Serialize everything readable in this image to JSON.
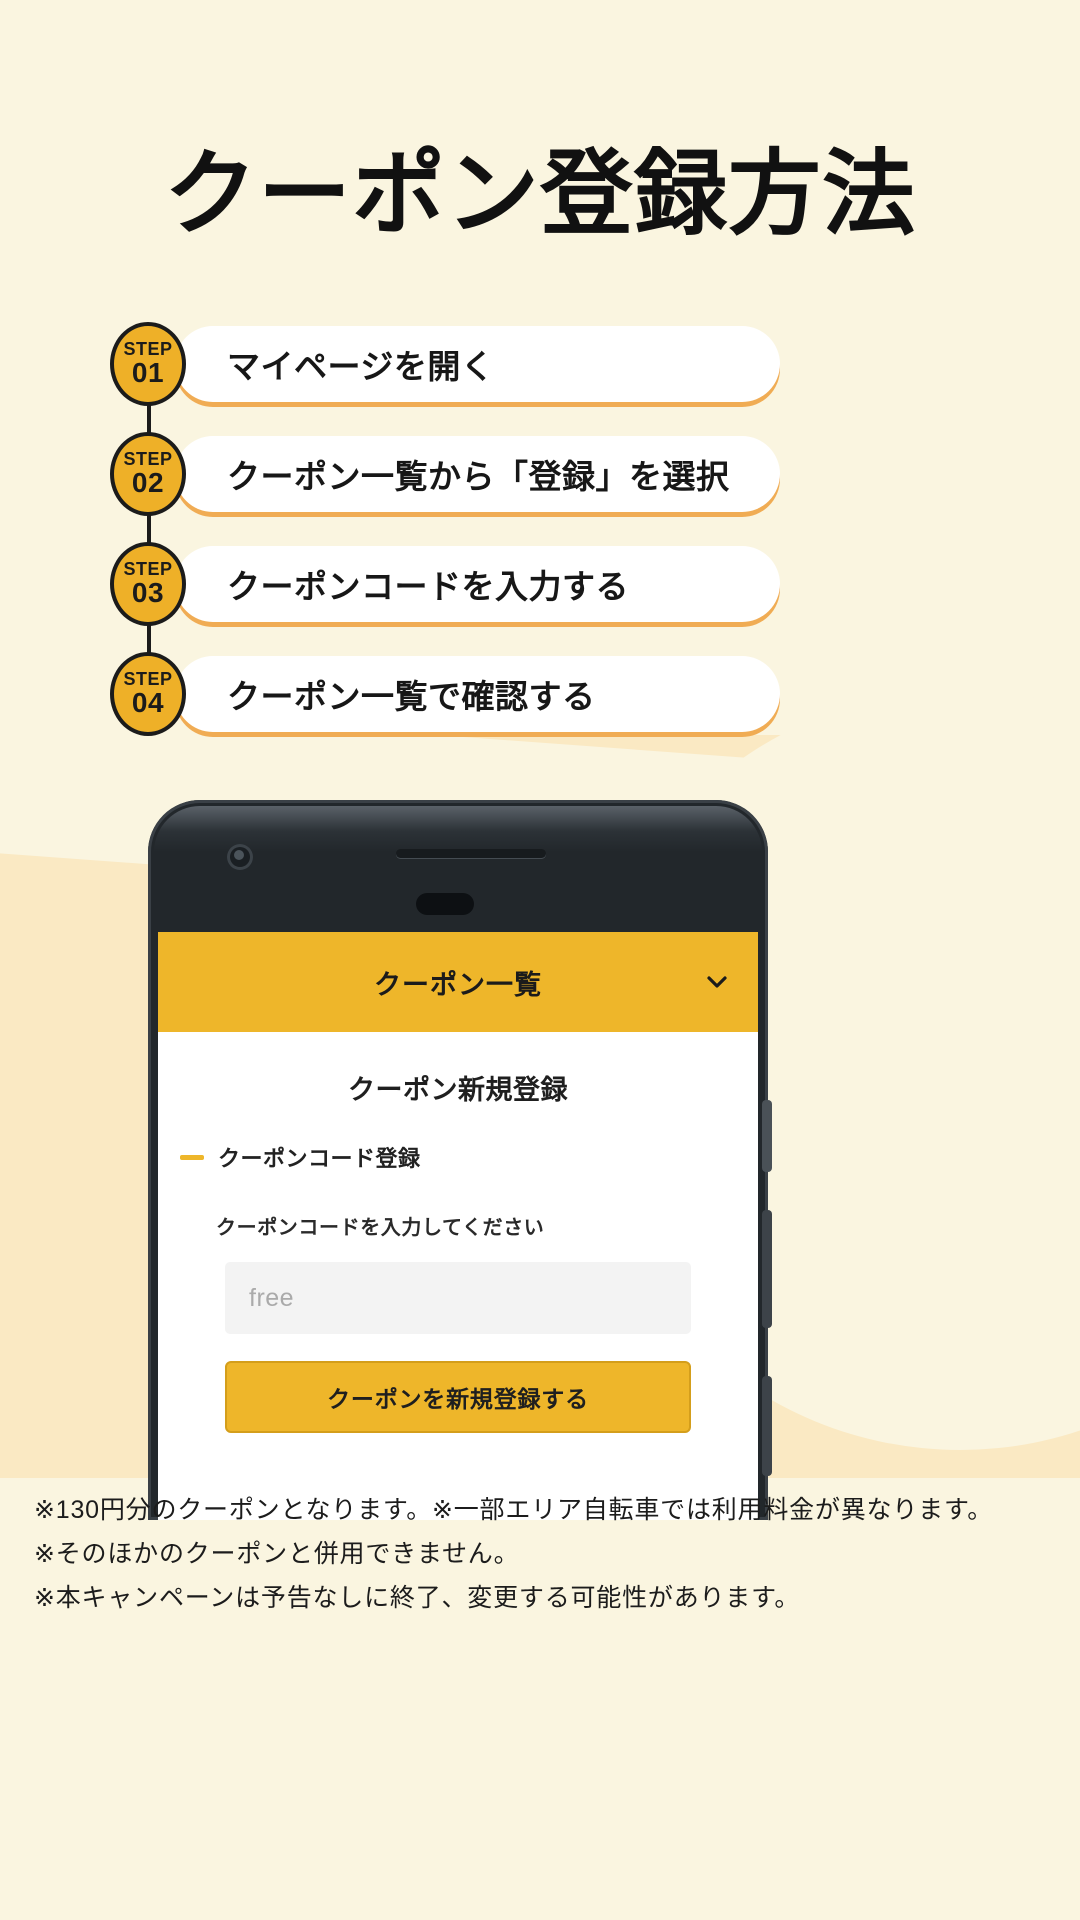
{
  "page": {
    "title": "クーポン登録方法",
    "background_color": "#faf5e0",
    "accent_color": "#eeb62a",
    "band_color": "#fae9c3"
  },
  "steps": [
    {
      "badge_word": "STEP",
      "badge_number": "01",
      "label": "マイページを開く"
    },
    {
      "badge_word": "STEP",
      "badge_number": "02",
      "label": "クーポン一覧から「登録」を選択"
    },
    {
      "badge_word": "STEP",
      "badge_number": "03",
      "label": "クーポンコードを入力する"
    },
    {
      "badge_word": "STEP",
      "badge_number": "04",
      "label": "クーポン一覧で確認する"
    }
  ],
  "phone": {
    "app": {
      "header": {
        "title": "クーポン一覧",
        "chevron_icon": "chevron-down-icon"
      },
      "section_title": "クーポン新規登録",
      "subhead": "クーポンコード登録",
      "field_label": "クーポンコードを入力してください",
      "input": {
        "value": "",
        "placeholder": "free"
      },
      "submit_label": "クーポンを新規登録する"
    }
  },
  "footer": {
    "lines": [
      "※130円分のクーポンとなります。※一部エリア自転車では利用料金が異なります。",
      "※そのほかのクーポンと併用できません。",
      "※本キャンペーンは予告なしに終了、変更する可能性があります。"
    ]
  }
}
